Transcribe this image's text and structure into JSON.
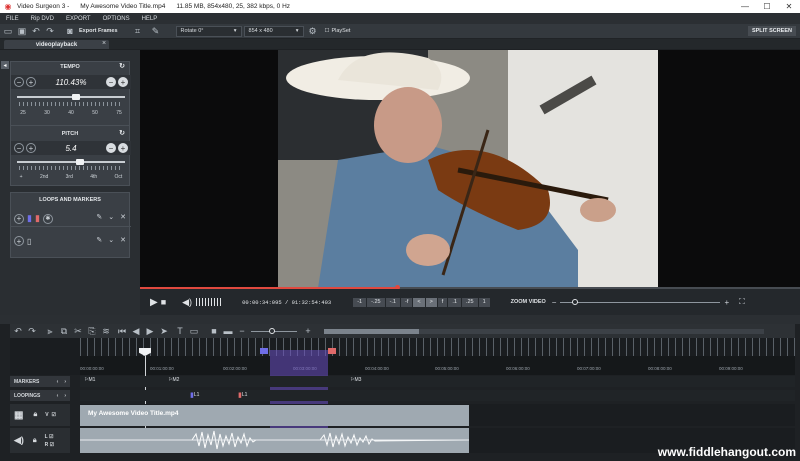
{
  "titlebar": {
    "app": "Video Surgeon 3 -",
    "filename": "My Awesome Video Title.mp4",
    "info": "11.85 MB, 854x480, 25, 382 kbps, 0 Hz"
  },
  "menu": [
    "FILE",
    "Rip DVD",
    "EXPORT",
    "OPTIONS",
    "HELP"
  ],
  "toolbar": {
    "export_frames": "Export Frames",
    "rotate": "Rotate 0°",
    "resolution": "854 x 480",
    "playset": "PlaySet",
    "split_screen": "SPLIT SCREEN"
  },
  "tab": {
    "label": "videoplayback"
  },
  "tempo": {
    "title": "TEMPO",
    "value": "110.43%",
    "level": 0.55,
    "ticks": [
      "25",
      "30",
      "40",
      "50",
      "75"
    ]
  },
  "pitch": {
    "title": "PITCH",
    "value": "5.4",
    "level": 0.58,
    "ticks": [
      "+",
      "2nd",
      "3rd",
      "4th",
      "Oct"
    ]
  },
  "loops": {
    "title": "LOOPS AND MARKERS"
  },
  "player": {
    "time": "00:00:34:095 / 01:32:54:403",
    "steps": [
      "-1",
      "-.25",
      "-.1",
      "-f",
      "<",
      ">",
      "f",
      ".1",
      ".25",
      "1"
    ],
    "zoom_label": "ZOOM VIDEO",
    "zoom_minus": "−",
    "zoom_plus": "+",
    "progress": 0.39,
    "zoom_level": 0.09
  },
  "ruler": {
    "times": [
      "00:00:00:00",
      "00:01:00:00",
      "00:02:00:00",
      "00:03:00:00",
      "00:04:00:00",
      "00:05:00:00",
      "00:06:00:00",
      "00:07:00:00",
      "00:08:00:00",
      "00:09:00:00"
    ]
  },
  "markers": {
    "label": "MARKERS",
    "items": [
      "M1",
      "M2",
      "M3"
    ]
  },
  "loopings": {
    "label": "LOOPINGS",
    "items": [
      "L1",
      "L1"
    ]
  },
  "clip": {
    "title": "My Awesome Video Title.mp4"
  },
  "track_labels": {
    "v": "V",
    "l": "L",
    "r": "R"
  },
  "footer": {
    "brand": "www.fiddlehangout.com"
  },
  "colors": {
    "accent_red": "#e0493f",
    "loop_purple": "#6a4fc2",
    "marker_blue": "#6f6ee8",
    "marker_red": "#e06a6a"
  }
}
